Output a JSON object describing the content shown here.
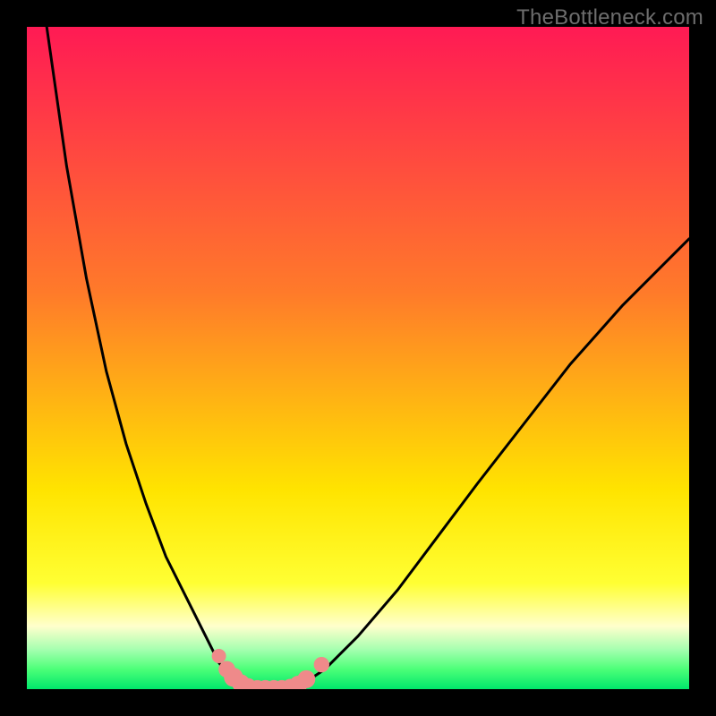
{
  "watermark": "TheBottleneck.com",
  "palette": {
    "pink_top": "#ff1a54",
    "orange": "#ff7a2a",
    "yellow": "#ffe400",
    "yellow_bright": "#ffff33",
    "pale_yellow": "#ffffcc",
    "pale_green": "#a6ffb0",
    "green1": "#4cff78",
    "green2": "#00e76b",
    "marker": "#ef8a8a",
    "curve": "#000000",
    "frame": "#000000"
  },
  "chart_data": {
    "type": "line",
    "title": "",
    "xlabel": "",
    "ylabel": "",
    "x_range": [
      0,
      100
    ],
    "y_range": [
      0,
      100
    ],
    "series": [
      {
        "name": "left-branch",
        "x": [
          3,
          6,
          9,
          12,
          15,
          18,
          21,
          24,
          27,
          29,
          30.5,
          32,
          33,
          34
        ],
        "y": [
          100,
          79,
          62,
          48,
          37,
          28,
          20,
          14,
          8,
          4,
          2,
          1,
          0.5,
          0.2
        ]
      },
      {
        "name": "right-branch",
        "x": [
          40,
          42,
          45,
          50,
          56,
          62,
          68,
          75,
          82,
          90,
          100
        ],
        "y": [
          0.2,
          1,
          3,
          8,
          15,
          23,
          31,
          40,
          49,
          58,
          68
        ]
      },
      {
        "name": "valley-floor",
        "x": [
          34,
          35,
          36,
          37,
          38,
          39,
          40
        ],
        "y": [
          0.2,
          0.1,
          0.1,
          0.1,
          0.1,
          0.1,
          0.2
        ]
      }
    ],
    "markers": [
      {
        "x": 29.0,
        "y": 5.0,
        "r": 1.2
      },
      {
        "x": 30.2,
        "y": 3.0,
        "r": 1.4
      },
      {
        "x": 31.2,
        "y": 1.8,
        "r": 1.6
      },
      {
        "x": 32.3,
        "y": 0.9,
        "r": 1.5
      },
      {
        "x": 33.4,
        "y": 0.4,
        "r": 1.4
      },
      {
        "x": 34.8,
        "y": 0.2,
        "r": 1.3
      },
      {
        "x": 36.0,
        "y": 0.2,
        "r": 1.3
      },
      {
        "x": 37.3,
        "y": 0.2,
        "r": 1.3
      },
      {
        "x": 38.5,
        "y": 0.2,
        "r": 1.3
      },
      {
        "x": 39.8,
        "y": 0.3,
        "r": 1.4
      },
      {
        "x": 41.0,
        "y": 0.7,
        "r": 1.5
      },
      {
        "x": 42.2,
        "y": 1.5,
        "r": 1.5
      },
      {
        "x": 44.5,
        "y": 3.7,
        "r": 1.3
      }
    ],
    "gradient_stops": [
      {
        "offset": 0.0,
        "color_key": "pink_top"
      },
      {
        "offset": 0.4,
        "color_key": "orange"
      },
      {
        "offset": 0.7,
        "color_key": "yellow"
      },
      {
        "offset": 0.84,
        "color_key": "yellow_bright"
      },
      {
        "offset": 0.905,
        "color_key": "pale_yellow"
      },
      {
        "offset": 0.94,
        "color_key": "pale_green"
      },
      {
        "offset": 0.97,
        "color_key": "green1"
      },
      {
        "offset": 1.0,
        "color_key": "green2"
      }
    ]
  }
}
